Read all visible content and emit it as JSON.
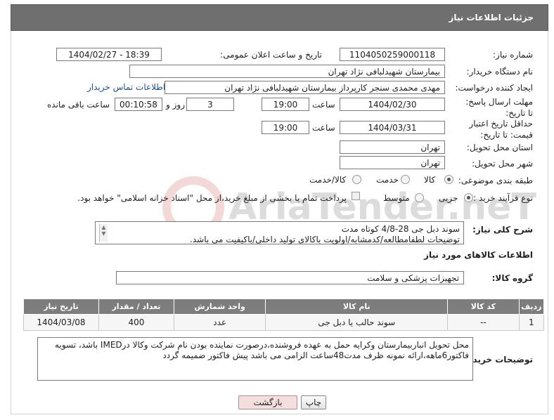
{
  "header": {
    "title": "جزئیات اطلاعات نیاز"
  },
  "fields": {
    "need_number_label": "شماره نیاز:",
    "need_number": "1104050259000118",
    "announce_label": "تاریخ و ساعت اعلان عمومی:",
    "announce_value": "1404/02/27 - 18:39",
    "buyer_label": "نام دستگاه خریدار:",
    "buyer_value": "بیمارستان شهیدلبافی نژاد تهران",
    "creator_label": "ایجاد کننده درخواست:",
    "creator_value": "مهدی محمدی سنجر کارپرداز بیمارستان شهیدلبافی نژاد تهران",
    "contact_link": "اطلاعات تماس خریدار",
    "deadline_label": "مهلت ارسال پاسخ: تا تاریخ:",
    "deadline_date": "1404/02/30",
    "time_label": "ساعت",
    "deadline_time": "19:00",
    "days_value": "3",
    "days_label": "روز و",
    "remaining_value": "00:10:58",
    "remaining_label": "ساعت باقی مانده",
    "validity_label": "حداقل تاریخ اعتبار قیمت: تا تاریخ:",
    "validity_date": "1404/03/31",
    "validity_time": "19:00",
    "province_label": "استان محل تحویل:",
    "province_value": "تهران",
    "city_label": "شهر محل تحویل:",
    "city_value": "تهران",
    "category_label": "طبقه بندی موضوعی:",
    "category_options": [
      "کالا",
      "خدمت",
      "کالا/خدمت"
    ],
    "category_selected": "کالا",
    "process_label": "نوع فرآیند خرید :",
    "process_options": [
      "جزیی",
      "متوسط"
    ],
    "process_selected": "جزیی",
    "payment_note": "پرداخت تمام یا بخشی از مبلغ خرید،از محل \"اسناد خزانه اسلامی\" خواهد بود.",
    "summary_label": "شرح کلی نیاز:",
    "summary_line1": "سوند دبل جی 28-4/8 کوتاه مدت",
    "summary_line2": "توضیحات لطفامطالعه/کدمشابه/اولویت باکالای تولید داخلی/باکیفیت می باشد.",
    "goods_info_title": "اطلاعات کالاهای مورد نیاز",
    "goods_group_label": "گروه کالا:",
    "goods_group_value": "تجهیزات پزشکی و سلامت",
    "buyer_notes_label": "توضیحات خریدار:",
    "buyer_notes_line1": "محل تحویل انباربیمارستان وکرایه حمل به عهده فروشنده،درصورت نماینده بودن نام شرکت وکالا درIMED باشد، تسویه",
    "buyer_notes_line2": "فاکتور6ماهه،ارائه نمونه ظرف مدت48ساعت الزامی می باشد پیش فاکتور ضمیمه گردد"
  },
  "table": {
    "headers": [
      "ردیف",
      "کد کالا",
      "نام کالا",
      "واحد شمارش",
      "تعداد / مقدار",
      "تاریخ نیاز"
    ],
    "rows": [
      [
        "1",
        "--",
        "سوند حالب یا دبل جی",
        "عدد",
        "400",
        "1404/03/08"
      ]
    ]
  },
  "buttons": {
    "print": "چاپ",
    "back": "بازگشت"
  },
  "watermark": "AriaTender.neT"
}
